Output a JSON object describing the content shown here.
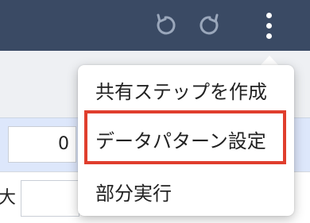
{
  "toolbar": {
    "undo_icon": "undo-icon",
    "redo_icon": "redo-icon",
    "more_icon": "more-vertical-icon",
    "background_color": "#3a4a64"
  },
  "background": {
    "row_b_input_value": "0",
    "row_c_label": "大"
  },
  "menu": {
    "items": [
      {
        "label": "共有ステップを作成"
      },
      {
        "label": "データパターン設定",
        "highlighted": true
      },
      {
        "label": "部分実行"
      }
    ],
    "highlight_color": "#e03e2d"
  }
}
